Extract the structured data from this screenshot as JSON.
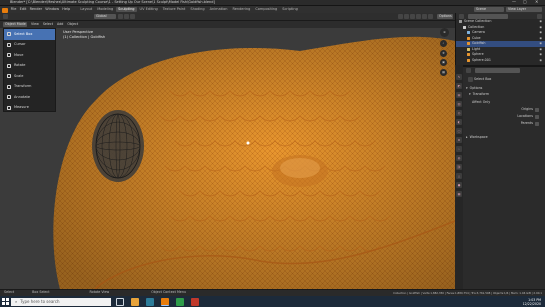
{
  "window": {
    "title": "Blender* [C:\\Blender\\Meshes\\Ultimate Sculpting Course\\1 - Setting Up Our Scene\\1 Sculpt\\Model Fish\\Goldfish.blend]",
    "controls": [
      "—",
      "▢",
      "✕"
    ]
  },
  "menu": {
    "items": [
      "File",
      "Edit",
      "Render",
      "Window",
      "Help"
    ],
    "workspaces": [
      "Layout",
      "Modeling",
      "Sculpting",
      "UV Editing",
      "Texture Paint",
      "Shading",
      "Animation",
      "Rendering",
      "Compositing",
      "Scripting"
    ],
    "active_workspace": "Sculpting",
    "scene_label": "Scene",
    "view_layer_label": "View Layer"
  },
  "viewport_header": {
    "mode": "Object Mode",
    "menus": [
      "View",
      "Select",
      "Add",
      "Object"
    ],
    "orientation": "Global",
    "options": "Options"
  },
  "viewport": {
    "view_name": "User Perspective",
    "collection_info": "(1) Collection | Goldfish",
    "mesh_color": "#e8962e",
    "wire_color": "#b8651a"
  },
  "toolbar": {
    "tools": [
      "Select Box",
      "Cursor",
      "Move",
      "Rotate",
      "Scale",
      "Transform",
      "Annotate",
      "Measure"
    ],
    "active": 0
  },
  "outliner": {
    "rows": [
      {
        "label": "Scene Collection",
        "color": "#9a9a9a",
        "indent": 0
      },
      {
        "label": "Collection",
        "color": "#cfcfcf",
        "indent": 1
      },
      {
        "label": "Camera",
        "color": "#7fb3e0",
        "indent": 2
      },
      {
        "label": "Cube",
        "color": "#e8962e",
        "indent": 2
      },
      {
        "label": "Goldfish",
        "color": "#e8962e",
        "indent": 2,
        "selected": true
      },
      {
        "label": "Light",
        "color": "#d9c46a",
        "indent": 2
      },
      {
        "label": "Sphere",
        "color": "#e8962e",
        "indent": 2
      },
      {
        "label": "Sphere.001",
        "color": "#e8962e",
        "indent": 2
      }
    ]
  },
  "properties": {
    "tool_name": "Select Box",
    "section_options": "Options",
    "subsection_transform": "Transform",
    "affect_only": "Affect Only",
    "checks": [
      "Origins",
      "Locations",
      "Parents"
    ],
    "section_workspace": "Workspace"
  },
  "statusbar": {
    "left": [
      "Select",
      "Box Select",
      "Rotate View",
      "Object Context Menu"
    ],
    "right": "Collection | Goldfish | Verts:1,882,350 | Faces:1,880,754 | Tris:3,761,508 | Objects:1/6 | Mem: 1.46 GiB | 2.90.1"
  },
  "taskbar": {
    "search_placeholder": "Type here to search",
    "time": "1:03 PM",
    "date": "12/22/2020"
  }
}
